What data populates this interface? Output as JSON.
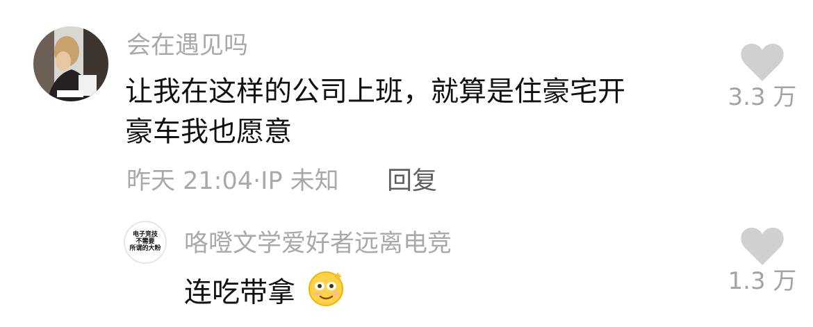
{
  "comments": [
    {
      "username": "会在遇见吗",
      "text_line1": "让我在这样的公司上班，就算是住豪宅开",
      "text_line2": "豪车我也愿意",
      "time_ip": "昨天 21:04·IP 未知",
      "reply_label": "回复",
      "likes": "3.3 万",
      "avatar": "photo-avatar"
    },
    {
      "username": "咯噔文学爱好者远离电竞",
      "avatar_text_line1": "电子竞技",
      "avatar_text_line2": "不需要",
      "avatar_text_line3": "所谓的大粉",
      "text": "连吃带拿",
      "emoji": "smiling-face-with-sparkle-emoji",
      "likes": "1.3 万"
    }
  ],
  "colors": {
    "text": "#111111",
    "muted": "#a9a9a9",
    "reply": "#5f5f5f",
    "heart": "#d0d0d0",
    "background": "#ffffff"
  }
}
